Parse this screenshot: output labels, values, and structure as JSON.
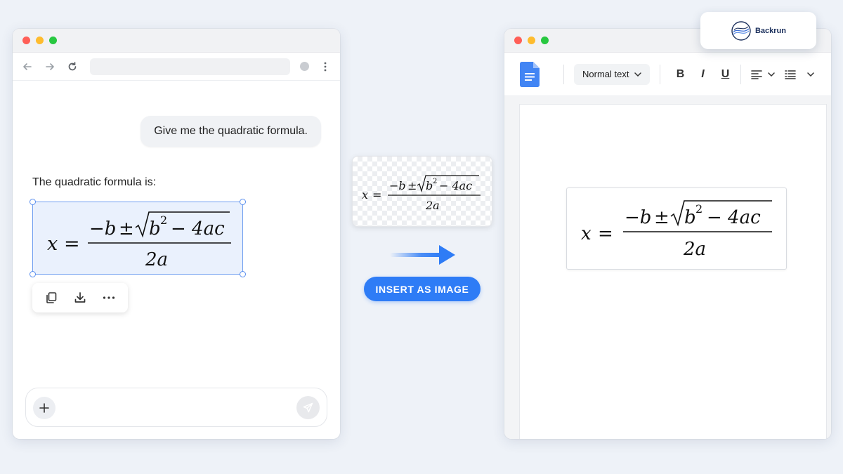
{
  "chat": {
    "user_message": "Give me the quadratic formula.",
    "assistant_intro": "The quadratic formula is:"
  },
  "formula": {
    "lhs": "x",
    "equals": "=",
    "minus_b": "−b",
    "pm": "±",
    "radicand_base": "b",
    "radicand_exp": "2",
    "radicand_rest": "− 4ac",
    "denominator": "2a"
  },
  "formula_actions": [
    "copy-icon",
    "download-icon",
    "more-icon"
  ],
  "insert_button_label": "INSERT AS IMAGE",
  "docs": {
    "style_select": "Normal text",
    "format_buttons": {
      "bold": "B",
      "italic": "I",
      "underline": "U"
    }
  },
  "badge": {
    "brand": "Backrun"
  },
  "colors": {
    "accent": "#2e7cf6",
    "selection_fill": "#eaf1fd",
    "selection_border": "#6f9ef0",
    "docs_blue": "#4285f4"
  }
}
